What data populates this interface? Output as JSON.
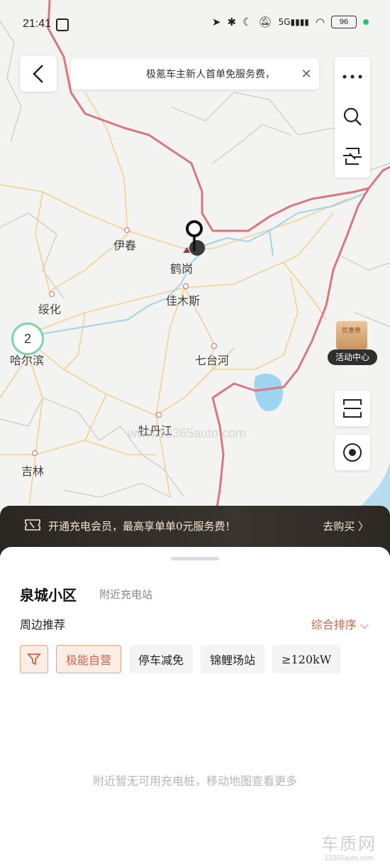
{
  "status": {
    "time": "21:41",
    "network": "5G",
    "battery": "96"
  },
  "notice": {
    "text": "极氪车主新人首单免服务费，",
    "close_glyph": "✕"
  },
  "map": {
    "cities": [
      {
        "name": "伊春"
      },
      {
        "name": "鹤岗"
      },
      {
        "name": "绥化"
      },
      {
        "name": "佳木斯"
      },
      {
        "name": "哈尔滨"
      },
      {
        "name": "七台河"
      },
      {
        "name": "牡丹江"
      },
      {
        "name": "吉林"
      }
    ],
    "cluster_count": "2",
    "watermark": "www.12365auto.com"
  },
  "promo": {
    "label": "活动中心",
    "box_text": "优惠券"
  },
  "vip_banner": {
    "message": "开通充电会员，最高享单单0元服务费！",
    "action": "去购买 〉"
  },
  "sheet": {
    "location": "泉城小区",
    "location_sub": "附近充电站",
    "section_title": "周边推荐",
    "sort_label": "综合排序 ⌵",
    "chips": [
      "极能自营",
      "停车减免",
      "锦鲤场站",
      "≥120kW"
    ],
    "empty_message": "附近暂无可用充电桩，移动地图查看更多"
  },
  "brand": {
    "logo": "车质网",
    "url": "12365auto.com"
  },
  "colors": {
    "accent": "#c8674a",
    "border_line": "#d9777f",
    "water": "#9fd4f0"
  }
}
